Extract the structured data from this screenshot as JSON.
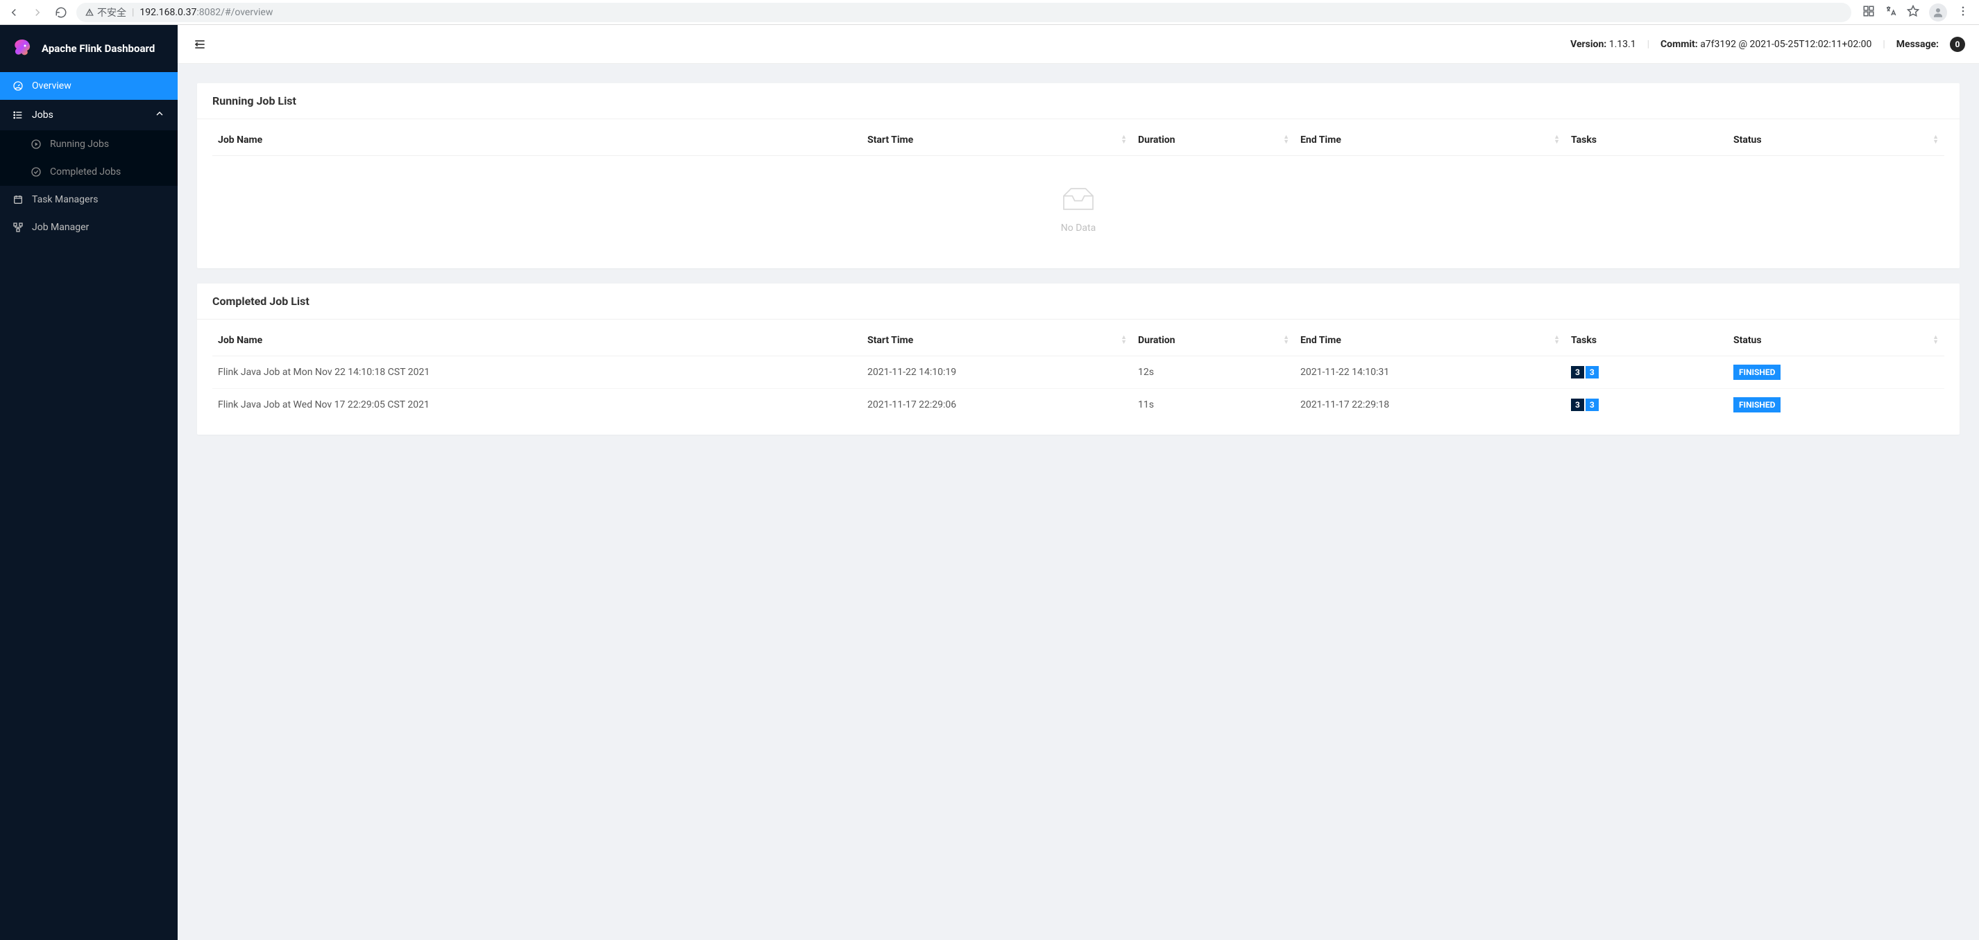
{
  "browser": {
    "insecure_label": "不安全",
    "url_host": "192.168.0.37",
    "url_port": ":8082",
    "url_path": "/#/overview"
  },
  "brand": {
    "title": "Apache Flink Dashboard"
  },
  "sidebar": {
    "overview": "Overview",
    "jobs": "Jobs",
    "running_jobs": "Running Jobs",
    "completed_jobs": "Completed Jobs",
    "task_managers": "Task Managers",
    "job_manager": "Job Manager"
  },
  "topbar": {
    "version_label": "Version:",
    "version_value": "1.13.1",
    "commit_label": "Commit:",
    "commit_value": "a7f3192 @ 2021-05-25T12:02:11+02:00",
    "message_label": "Message:",
    "message_count": "0"
  },
  "running": {
    "title": "Running Job List",
    "columns": {
      "name": "Job Name",
      "start": "Start Time",
      "duration": "Duration",
      "end": "End Time",
      "tasks": "Tasks",
      "status": "Status"
    },
    "empty": "No Data"
  },
  "completed": {
    "title": "Completed Job List",
    "columns": {
      "name": "Job Name",
      "start": "Start Time",
      "duration": "Duration",
      "end": "End Time",
      "tasks": "Tasks",
      "status": "Status"
    },
    "rows": [
      {
        "name": "Flink Java Job at Mon Nov 22 14:10:18 CST 2021",
        "start": "2021-11-22 14:10:19",
        "duration": "12s",
        "end": "2021-11-22 14:10:31",
        "tasks_a": "3",
        "tasks_b": "3",
        "status": "FINISHED"
      },
      {
        "name": "Flink Java Job at Wed Nov 17 22:29:05 CST 2021",
        "start": "2021-11-17 22:29:06",
        "duration": "11s",
        "end": "2021-11-17 22:29:18",
        "tasks_a": "3",
        "tasks_b": "3",
        "status": "FINISHED"
      }
    ]
  }
}
